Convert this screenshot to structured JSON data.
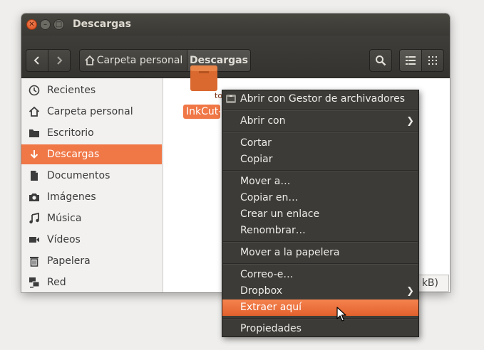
{
  "window": {
    "title": "Descargas"
  },
  "toolbar": {
    "breadcrumb_home": "Carpeta personal",
    "breadcrumb_current": "Descargas"
  },
  "sidebar": {
    "items": [
      {
        "label": "Recientes",
        "icon": "clock-icon"
      },
      {
        "label": "Carpeta personal",
        "icon": "home-icon"
      },
      {
        "label": "Escritorio",
        "icon": "folder-icon"
      },
      {
        "label": "Descargas",
        "icon": "download-icon",
        "active": true
      },
      {
        "label": "Documentos",
        "icon": "document-icon"
      },
      {
        "label": "Imágenes",
        "icon": "camera-icon"
      },
      {
        "label": "Música",
        "icon": "music-icon"
      },
      {
        "label": "Vídeos",
        "icon": "video-icon"
      },
      {
        "label": "Papelera",
        "icon": "trash-icon"
      },
      {
        "label": "Red",
        "icon": "network-icon"
      }
    ]
  },
  "file": {
    "name": "InkCut-",
    "icon_text": "to"
  },
  "statusbar": {
    "text": "kB)"
  },
  "context_menu": {
    "items": [
      "Abrir con Gestor de archivadores",
      "Abrir con",
      "Cortar",
      "Copiar",
      "Mover a…",
      "Copiar en…",
      "Crear un enlace",
      "Renombrar…",
      "Mover a la papelera",
      "Correo-e…",
      "Dropbox",
      "Extraer aquí",
      "Propiedades"
    ],
    "highlighted": "Extraer aquí"
  },
  "colors": {
    "accent": "#f07746",
    "titlebar": "#3c3b37"
  }
}
